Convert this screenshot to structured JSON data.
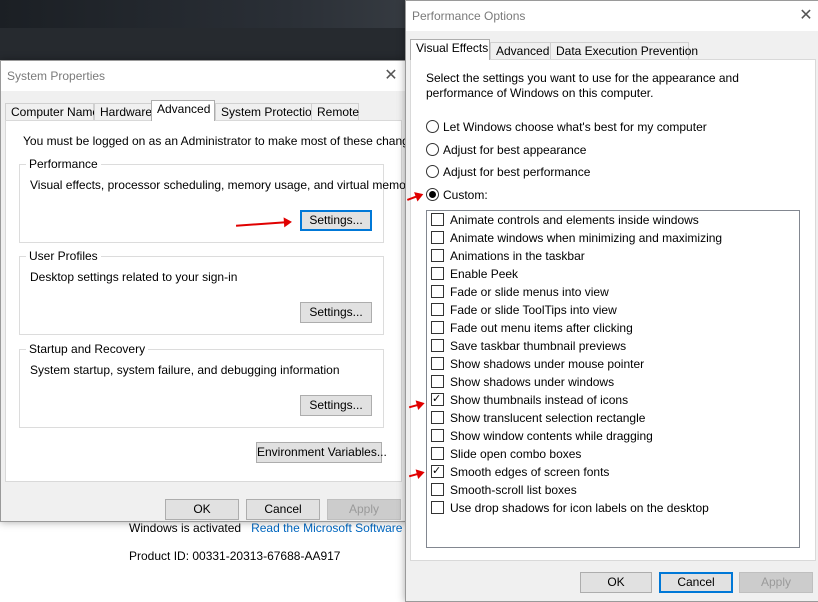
{
  "background": {
    "activation_text": "Windows is activated",
    "activation_link": "Read the Microsoft Software",
    "product_id": "Product ID:  00331-20313-67688-AA917"
  },
  "system_properties": {
    "title": "System Properties",
    "tabs": [
      "Computer Name",
      "Hardware",
      "Advanced",
      "System Protection",
      "Remote"
    ],
    "active_tab": "Advanced",
    "admin_note": "You must be logged on as an Administrator to make most of these changes.",
    "groups": [
      {
        "title": "Performance",
        "desc": "Visual effects, processor scheduling, memory usage, and virtual memory",
        "button": "Settings..."
      },
      {
        "title": "User Profiles",
        "desc": "Desktop settings related to your sign-in",
        "button": "Settings..."
      },
      {
        "title": "Startup and Recovery",
        "desc": "System startup, system failure, and debugging information",
        "button": "Settings..."
      }
    ],
    "env_button": "Environment Variables...",
    "ok": "OK",
    "cancel": "Cancel",
    "apply": "Apply"
  },
  "performance_options": {
    "title": "Performance Options",
    "tabs": [
      "Visual Effects",
      "Advanced",
      "Data Execution Prevention"
    ],
    "active_tab": "Visual Effects",
    "intro_line1": "Select the settings you want to use for the appearance and",
    "intro_line2": "performance of Windows on this computer.",
    "radios": [
      {
        "label": "Let Windows choose what's best for my computer",
        "selected": false
      },
      {
        "label": "Adjust for best appearance",
        "selected": false
      },
      {
        "label": "Adjust for best performance",
        "selected": false
      },
      {
        "label": "Custom:",
        "selected": true
      }
    ],
    "effects": [
      {
        "label": "Animate controls and elements inside windows",
        "checked": false
      },
      {
        "label": "Animate windows when minimizing and maximizing",
        "checked": false
      },
      {
        "label": "Animations in the taskbar",
        "checked": false
      },
      {
        "label": "Enable Peek",
        "checked": false
      },
      {
        "label": "Fade or slide menus into view",
        "checked": false
      },
      {
        "label": "Fade or slide ToolTips into view",
        "checked": false
      },
      {
        "label": "Fade out menu items after clicking",
        "checked": false
      },
      {
        "label": "Save taskbar thumbnail previews",
        "checked": false
      },
      {
        "label": "Show shadows under mouse pointer",
        "checked": false
      },
      {
        "label": "Show shadows under windows",
        "checked": false
      },
      {
        "label": "Show thumbnails instead of icons",
        "checked": true
      },
      {
        "label": "Show translucent selection rectangle",
        "checked": false
      },
      {
        "label": "Show window contents while dragging",
        "checked": false
      },
      {
        "label": "Slide open combo boxes",
        "checked": false
      },
      {
        "label": "Smooth edges of screen fonts",
        "checked": true
      },
      {
        "label": "Smooth-scroll list boxes",
        "checked": false
      },
      {
        "label": "Use drop shadows for icon labels on the desktop",
        "checked": false
      }
    ],
    "ok": "OK",
    "cancel": "Cancel",
    "apply": "Apply"
  },
  "colors": {
    "annotation_arrow": "#e00000",
    "focus_blue": "#0078d7"
  }
}
